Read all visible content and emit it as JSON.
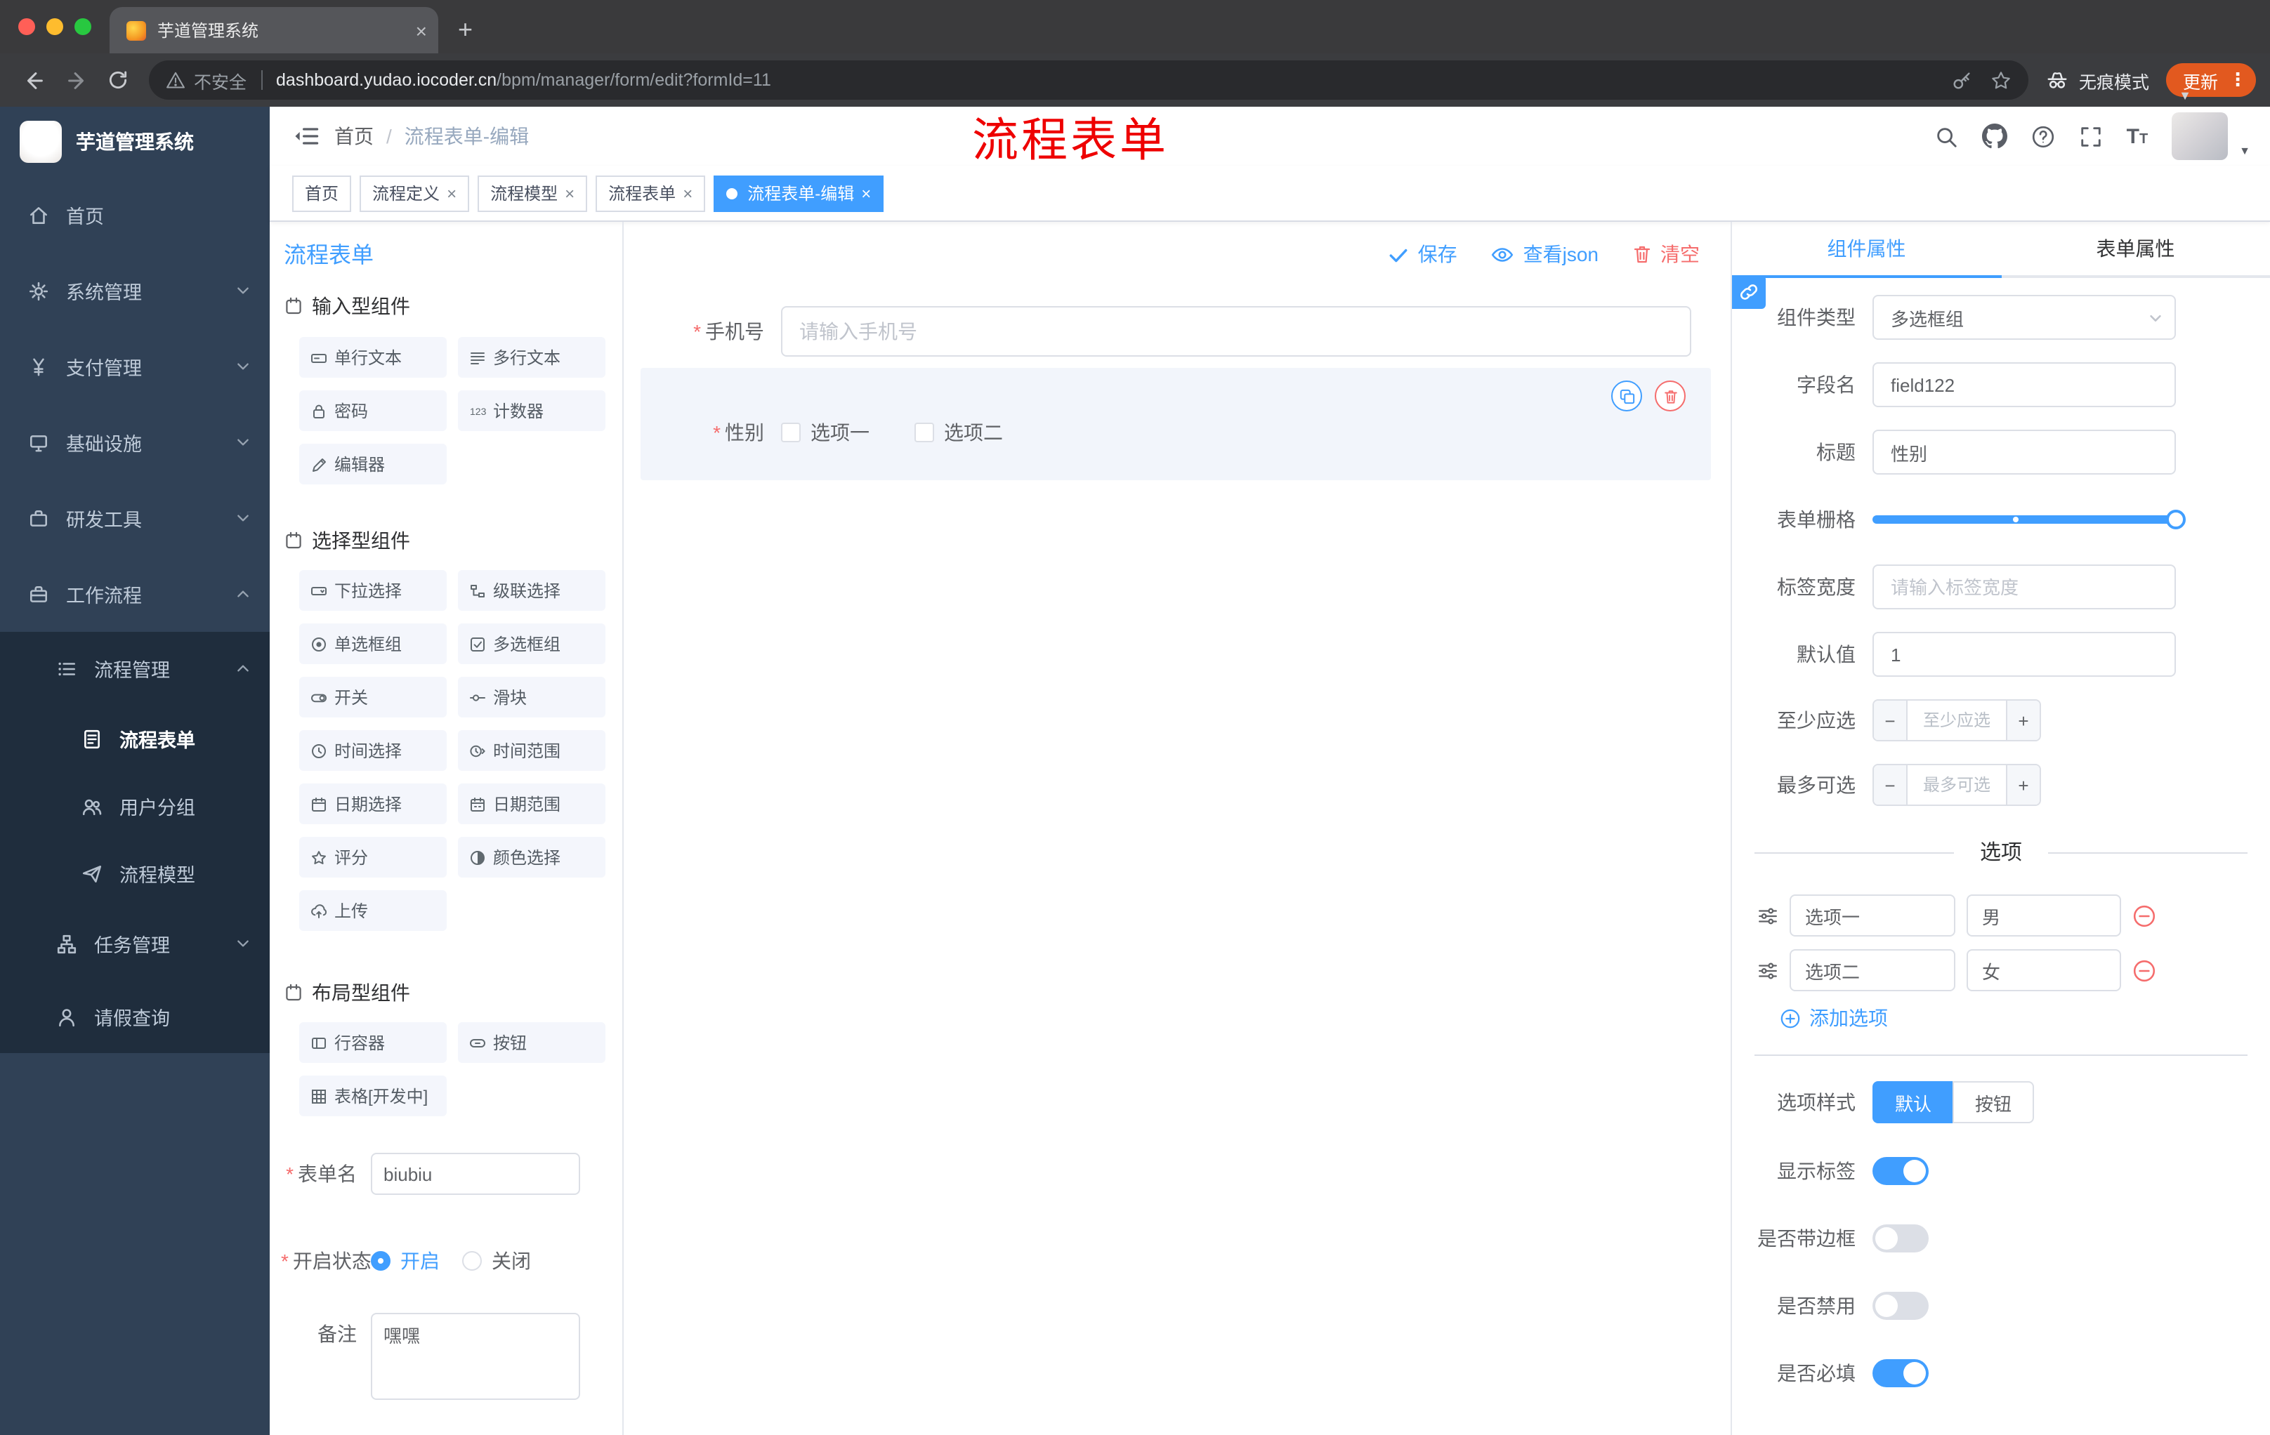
{
  "colors": {
    "primary": "#409eff",
    "danger": "#f56c6c",
    "annotation_red": "#ee0000",
    "update_badge_orange": "#e2591f",
    "sidebar_bg": "#304156",
    "sidebar_submenu_bg": "#1f2d3d"
  },
  "browser": {
    "tab_title": "芋道管理系统",
    "security_label": "不安全",
    "url_host": "dashboard.yudao.iocoder.cn",
    "url_path": "/bpm/manager/form/edit?formId=11",
    "incognito_label": "无痕模式",
    "update_label": "更新"
  },
  "sidebar": {
    "app_title": "芋道管理系统",
    "items": [
      {
        "label": "首页"
      },
      {
        "label": "系统管理"
      },
      {
        "label": "支付管理"
      },
      {
        "label": "基础设施"
      },
      {
        "label": "研发工具"
      },
      {
        "label": "工作流程"
      },
      {
        "label": "流程管理"
      },
      {
        "label": "流程表单"
      },
      {
        "label": "用户分组"
      },
      {
        "label": "流程模型"
      },
      {
        "label": "任务管理"
      },
      {
        "label": "请假查询"
      }
    ]
  },
  "header": {
    "breadcrumb_home": "首页",
    "breadcrumb_current": "流程表单-编辑",
    "annotation": "流程表单"
  },
  "tags": [
    {
      "label": "首页"
    },
    {
      "label": "流程定义"
    },
    {
      "label": "流程模型"
    },
    {
      "label": "流程表单"
    },
    {
      "label": "流程表单-编辑"
    }
  ],
  "designer": {
    "title": "流程表单",
    "groups": [
      {
        "title": "输入型组件",
        "items": [
          "单行文本",
          "多行文本",
          "密码",
          "计数器",
          "编辑器"
        ]
      },
      {
        "title": "选择型组件",
        "items": [
          "下拉选择",
          "级联选择",
          "单选框组",
          "多选框组",
          "开关",
          "滑块",
          "时间选择",
          "时间范围",
          "日期选择",
          "日期范围",
          "评分",
          "颜色选择",
          "上传"
        ]
      },
      {
        "title": "布局型组件",
        "items": [
          "行容器",
          "按钮",
          "表格[开发中]"
        ]
      }
    ],
    "form": {
      "name_label": "表单名",
      "name_value": "biubiu",
      "status_label": "开启状态",
      "status_on": "开启",
      "status_off": "关闭",
      "remark_label": "备注",
      "remark_value": "嘿嘿"
    }
  },
  "canvas": {
    "toolbar": {
      "save": "保存",
      "view_json": "查看json",
      "clear": "清空"
    },
    "phone": {
      "label": "手机号",
      "placeholder": "请输入手机号"
    },
    "gender": {
      "label": "性别",
      "option1": "选项一",
      "option2": "选项二"
    }
  },
  "properties": {
    "tab_component": "组件属性",
    "tab_form": "表单属性",
    "rows": {
      "type_label": "组件类型",
      "type_value": "多选框组",
      "field_label": "字段名",
      "field_value": "field122",
      "title_label": "标题",
      "title_value": "性别",
      "grid_label": "表单栅格",
      "width_label": "标签宽度",
      "width_placeholder": "请输入标签宽度",
      "default_label": "默认值",
      "default_value": "1",
      "min_label": "至少应选",
      "min_placeholder": "至少应选",
      "max_label": "最多可选",
      "max_placeholder": "最多可选"
    },
    "options_title": "选项",
    "options": [
      {
        "name": "选项一",
        "value": "男"
      },
      {
        "name": "选项二",
        "value": "女"
      }
    ],
    "add_option": "添加选项",
    "style_label": "选项样式",
    "style_default": "默认",
    "style_button": "按钮",
    "toggle_show_label": "显示标签",
    "toggle_border": "是否带边框",
    "toggle_disabled": "是否禁用",
    "toggle_required": "是否必填"
  }
}
